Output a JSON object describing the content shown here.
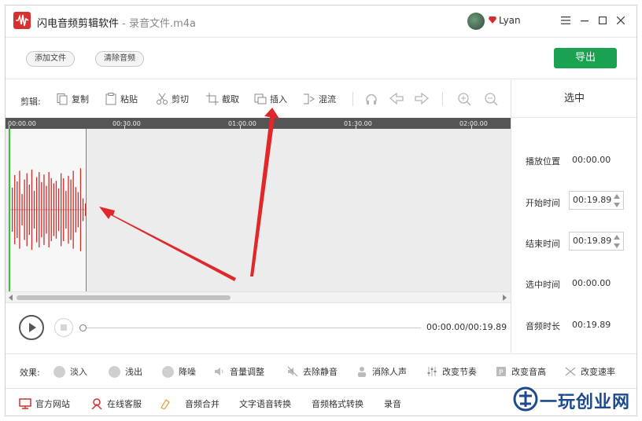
{
  "app": {
    "title": "闪电音频剪辑软件",
    "separator": " - ",
    "file_name": "录音文件.m4a",
    "user_name": "Lyan"
  },
  "toolbar": {
    "add_file": "添加文件",
    "clear_audio": "清除音频",
    "export": "导出"
  },
  "edit": {
    "label": "剪辑:",
    "copy": "复制",
    "paste": "粘贴",
    "cut": "剪切",
    "crop": "截取",
    "insert": "插入",
    "mix": "混流"
  },
  "timeline": {
    "ticks": [
      "00:00.00",
      "00:30.00",
      "01:00.00",
      "01:30.00",
      "02:00.00"
    ]
  },
  "player": {
    "time": "00:00.00/00:19.89",
    "progress": 0
  },
  "panel": {
    "title": "选中",
    "play_position_label": "播放位置",
    "play_position": "00:00.00",
    "start_time_label": "开始时间",
    "start_time": "00:19.89",
    "end_time_label": "结束时间",
    "end_time": "00:19.89",
    "selected_time_label": "选中时间",
    "selected_time": "00:00.00",
    "duration_label": "音频时长",
    "duration": "00:19.89"
  },
  "effects": {
    "label": "效果:",
    "fade_in": "淡入",
    "fade_out": "浅出",
    "denoise": "降噪",
    "volume": "音量调整",
    "remove_silence": "去除静音",
    "remove_vocals": "消除人声",
    "change_tempo": "改变节奏",
    "change_pitch": "改变音高",
    "change_speed": "改变速率"
  },
  "bottom": {
    "website": "官方网站",
    "support": "在线客服",
    "merge": "音频合并",
    "tts": "文字语音转换",
    "format": "音频格式转换",
    "record": "录音"
  },
  "watermark": {
    "text": "一玩创业网"
  },
  "colors": {
    "accent_green": "#1aa251",
    "wave_red": "#c8302e",
    "arrow_red": "#e0282a",
    "timeline_bg": "#555555"
  }
}
